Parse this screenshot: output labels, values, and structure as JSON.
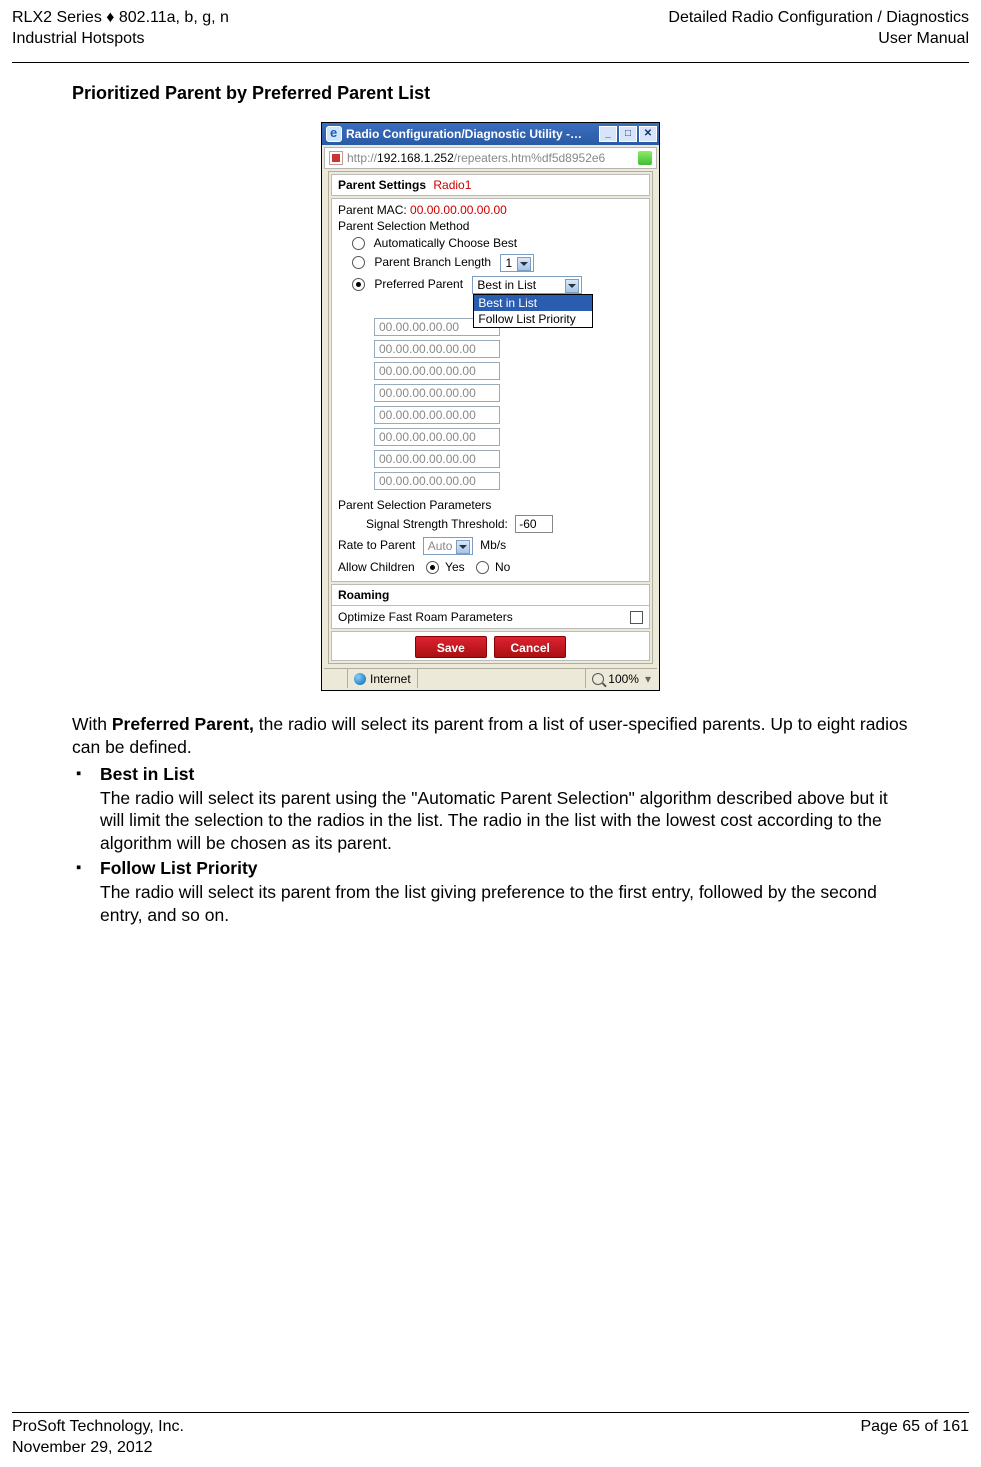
{
  "header": {
    "left_line1": "RLX2 Series ♦ 802.11a, b, g, n",
    "left_line2": "Industrial Hotspots",
    "right_line1": "Detailed Radio Configuration / Diagnostics",
    "right_line2": "User Manual"
  },
  "section_title": "Prioritized Parent by Preferred Parent List",
  "screenshot": {
    "window_title": "Radio Configuration/Diagnostic Utility -…",
    "url_prefix": "http://",
    "url_ip": "192.168.1.252",
    "url_path": "/repeaters.htm%df5d8952e6",
    "win_min": "_",
    "win_max": "□",
    "win_close": "✕",
    "parent_settings_label": "Parent Settings",
    "radio_name": "Radio1",
    "parent_mac_label": "Parent MAC:",
    "parent_mac_value": "00.00.00.00.00.00",
    "selection_method_label": "Parent Selection Method",
    "opt_auto": "Automatically Choose Best",
    "opt_branch": "Parent Branch Length",
    "branch_value": "1",
    "opt_preferred": "Preferred Parent",
    "preferred_sel_value": "Best in List",
    "dropdown_opts": [
      "Best in List",
      "Follow List Priority"
    ],
    "mac_list": [
      "00.00.00.00.00",
      "00.00.00.00.00.00",
      "00.00.00.00.00.00",
      "00.00.00.00.00.00",
      "00.00.00.00.00.00",
      "00.00.00.00.00.00",
      "00.00.00.00.00.00",
      "00.00.00.00.00.00"
    ],
    "params_label": "Parent Selection Parameters",
    "sst_label": "Signal Strength Threshold:",
    "sst_value": "-60",
    "rate_label": "Rate to Parent",
    "rate_value": "Auto",
    "rate_unit": "Mb/s",
    "allow_children_label": "Allow Children",
    "yes": "Yes",
    "no": "No",
    "roaming_label": "Roaming",
    "roaming_opt": "Optimize Fast Roam Parameters",
    "btn_save": "Save",
    "btn_cancel": "Cancel",
    "status_internet": "Internet",
    "zoom": "100%"
  },
  "body": {
    "intro_pre": "With ",
    "intro_strong": "Preferred Parent,",
    "intro_post": " the radio will select its parent from a list of user-specified parents. Up to eight radios can be defined.",
    "items": [
      {
        "title": "Best in List",
        "text": "The radio will select its parent using the \"Automatic Parent Selection\" algorithm described above but it will limit the selection to the radios in the list. The radio in the list with the lowest cost according to the algorithm will be chosen as its parent."
      },
      {
        "title": "Follow List Priority",
        "text": "The radio will select its parent from the list giving preference to the first entry, followed by the second entry, and so on."
      }
    ]
  },
  "footer": {
    "left_line1": "ProSoft Technology, Inc.",
    "left_line2": "November 29, 2012",
    "right_line1": "Page 65 of 161"
  }
}
